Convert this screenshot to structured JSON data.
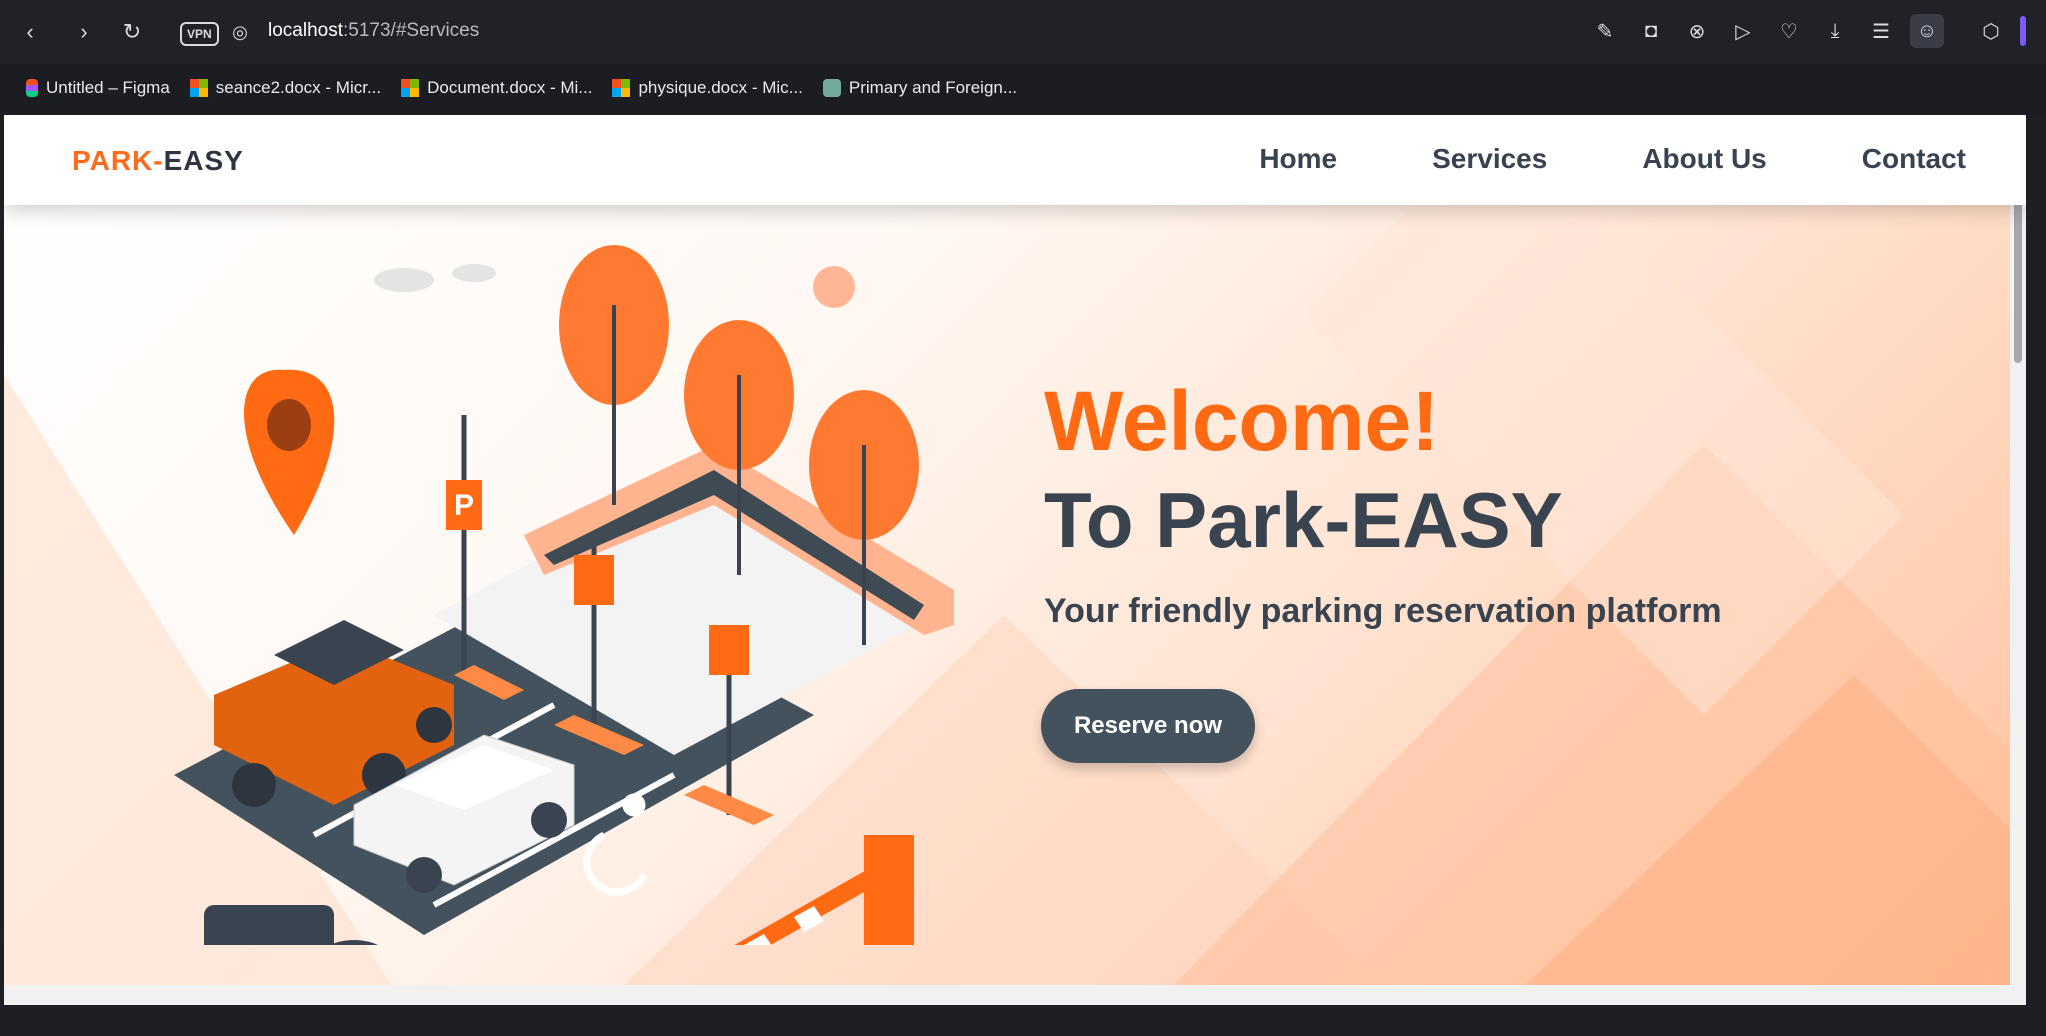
{
  "browser": {
    "url_host": "localhost",
    "url_path": ":5173/#Services",
    "vpn_label": "VPN",
    "bookmarks": [
      {
        "label": "Untitled – Figma",
        "icon": "figma-icon"
      },
      {
        "label": "seance2.docx - Micr...",
        "icon": "microsoft-icon"
      },
      {
        "label": "Document.docx - Mi...",
        "icon": "microsoft-icon"
      },
      {
        "label": "physique.docx - Mic...",
        "icon": "microsoft-icon"
      },
      {
        "label": "Primary and Foreign...",
        "icon": "chatgpt-icon"
      }
    ]
  },
  "site": {
    "logo_part1": "PARK-",
    "logo_part2": "EASY",
    "nav": [
      {
        "label": "Home"
      },
      {
        "label": "Services"
      },
      {
        "label": "About Us"
      },
      {
        "label": "Contact"
      }
    ],
    "hero": {
      "welcome": "Welcome!",
      "title": "To Park-EASY",
      "tagline": "Your friendly parking reservation platform",
      "cta": "Reserve now"
    },
    "colors": {
      "accent": "#ff6a12",
      "dark": "#3a4450",
      "button": "#44525e"
    }
  }
}
